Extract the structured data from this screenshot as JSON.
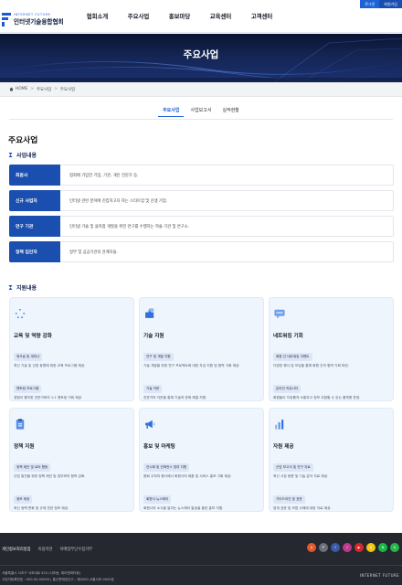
{
  "util": {
    "login": "로그인",
    "join": "회원가입"
  },
  "logo": {
    "en": "INTERNET FUTURE",
    "ko": "인터넷기술융합협회"
  },
  "gnb": [
    "협회소개",
    "주요사업",
    "홍보마당",
    "교육센터",
    "고객센터"
  ],
  "hero": {
    "title": "주요사업"
  },
  "breadcrumb": {
    "home": "HOME",
    "level1": "주요사업",
    "level2": "주요사업"
  },
  "tabs": [
    {
      "label": "주요사업",
      "active": true
    },
    {
      "label": "사업보고서",
      "active": false
    },
    {
      "label": "실적현황",
      "active": false
    }
  ],
  "page_title": "주요사업",
  "section_business": "사업내용",
  "business": [
    {
      "label": "회원사",
      "desc": "협회에 가입한 기업, 기관, 개인 전문가 등."
    },
    {
      "label": "신규 사업자",
      "desc": "인터넷 관련 분야에 진입하고자 하는 스타트업 및 신생 기업."
    },
    {
      "label": "연구 기관",
      "desc": "인터넷 기술 및 융복합 개발을 위한 연구를 수행하는 학술 기관 및 연구소."
    },
    {
      "label": "정책 입안자",
      "desc": "정부 및 공공기관의 관계자들."
    }
  ],
  "section_support": "지원내용",
  "cards": [
    {
      "icon": "sparkle-icon",
      "title": "교육 및 역량 강화",
      "items": [
        {
          "tag": "워크숍 및 세미나",
          "desc": "최신 기술 및 산업 동향에 대한 교육 프로그램 제공."
        },
        {
          "tag": "멘토링 프로그램",
          "desc": "경험이 풍부한 전문가와의 1:1 멘토링 기회 제공."
        }
      ]
    },
    {
      "icon": "puzzle-icon",
      "title": "기술 지원",
      "items": [
        {
          "tag": "연구 및 개발 지원",
          "desc": "기술 개발을 위한 연구 프로젝트에 대한 자금 지원 및 협력 기회 제공."
        },
        {
          "tag": "기술 자문",
          "desc": "전문가의 자문을 통해 기술적 문제 해결 지원."
        }
      ]
    },
    {
      "icon": "chat-icon",
      "title": "네트워킹 기회",
      "items": [
        {
          "tag": "회원 간 네트워킹 이벤트",
          "desc": "다양한 행사 및 모임을 통해 회원 간의 협력 기회 마련."
        },
        {
          "tag": "온라인 커뮤니티",
          "desc": "회원들이 자유롭게 소통하고 정보 교환할 수 있는 플랫폼 운영."
        }
      ]
    },
    {
      "icon": "document-icon",
      "title": "정책 지원",
      "items": [
        {
          "tag": "정책 제안 및 로비 활동",
          "desc": "산업 발전을 위한 정책 제안 및 정부와의 협력 강화."
        },
        {
          "tag": "정보 제공",
          "desc": "최신 정책 변화 및 규제 관련 정보 제공."
        }
      ]
    },
    {
      "icon": "megaphone-icon",
      "title": "홍보 및 마케팅",
      "items": [
        {
          "tag": "전시회 및 컨퍼런스 참여 지원",
          "desc": "협회 주최의 행사에서 회원사의 제품 및 서비스 홍보 기회 제공."
        },
        {
          "tag": "회원사 뉴스레터",
          "desc": "회원사의 소식을 알리는 뉴스레터 발송을 통한 홍보 지원."
        }
      ]
    },
    {
      "icon": "chart-icon",
      "title": "자원 제공",
      "items": [
        {
          "tag": "산업 보고서 및 연구 자료",
          "desc": "최신 시장 동향 및 기술 분석 자료 제공."
        },
        {
          "tag": "가이드라인 및 표준",
          "desc": "업계 표준 및 모범 사례에 대한 자료 제공."
        }
      ]
    }
  ],
  "footer": {
    "links": [
      "개인정보처리방침",
      "이용약관",
      "이메일무단수집거부"
    ],
    "social": [
      {
        "icon": "blog-icon",
        "color": "#e05a2b",
        "text": "b"
      },
      {
        "icon": "post-icon",
        "color": "#6a6f7a",
        "text": "P"
      },
      {
        "icon": "facebook-icon",
        "color": "#3b5ba8",
        "text": "f"
      },
      {
        "icon": "instagram-icon",
        "color": "#c0398a",
        "text": "I"
      },
      {
        "icon": "youtube-icon",
        "color": "#d6282b",
        "text": "▶"
      },
      {
        "icon": "kakao-icon",
        "color": "#f2c811",
        "text": "K"
      },
      {
        "icon": "naver-icon",
        "color": "#19b84a",
        "text": "N"
      },
      {
        "icon": "band-icon",
        "color": "#2ab54b",
        "text": "b"
      }
    ],
    "address": "서울특별시 서초구 서초대로 524 (서초동, 제이앤피타워)",
    "biz": "사업자등록번호 : 000-00-00000 | 통신판매업신고 : 제0000-서울서초-0000호",
    "logo": "INTERNET FUTURE"
  },
  "colors": {
    "primary": "#1a4fb0",
    "accent": "#1e63d6",
    "navy": "#142553",
    "card_bg": "#eef5fd",
    "footer_bg": "#25282e"
  }
}
